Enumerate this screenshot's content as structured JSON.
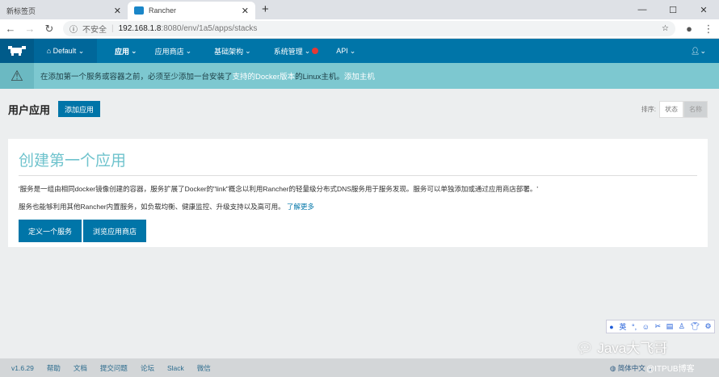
{
  "browser": {
    "tabs": [
      {
        "label": "新标签页"
      },
      {
        "label": "Rancher"
      }
    ],
    "url_insecure": "不安全",
    "url_host": "192.168.1.8",
    "url_path": ":8080/env/1a5/apps/stacks"
  },
  "nav": {
    "env": "Default",
    "items": [
      "应用",
      "应用商店",
      "基础架构",
      "系统管理",
      "API"
    ]
  },
  "warning": {
    "text": "在添加第一个服务或容器之前，必须至少添加一台安装了",
    "link1": "支持的Docker版本",
    "text2": " 的Linux主机。",
    "link2": "添加主机"
  },
  "header": {
    "title": "用户应用",
    "add_button": "添加应用",
    "sort_label": "排序:",
    "sort_options": [
      "状态",
      "名称"
    ]
  },
  "card": {
    "title": "创建第一个应用",
    "p1": "'服务是一组由相同docker镜像创建的容器，服务扩展了Docker的\"link\"概念以利用Rancher的轻量级分布式DNS服务用于服务发现。服务可以单独添加或通过应用商店部署。'",
    "p2": "服务也能够利用其他Rancher内置服务，如负载均衡、健康监控、升级支持以及高可用。",
    "learn_more": "了解更多",
    "btn_service": "定义一个服务",
    "btn_catalog": "浏览应用商店"
  },
  "ime": {
    "lang": "英"
  },
  "watermark": "Java大飞哥",
  "watermark2": "@ITPUB博客",
  "footer": {
    "version": "v1.6.29",
    "links": [
      "帮助",
      "文档",
      "提交问题",
      "论坛",
      "Slack",
      "微信"
    ],
    "language": "简体中文"
  }
}
